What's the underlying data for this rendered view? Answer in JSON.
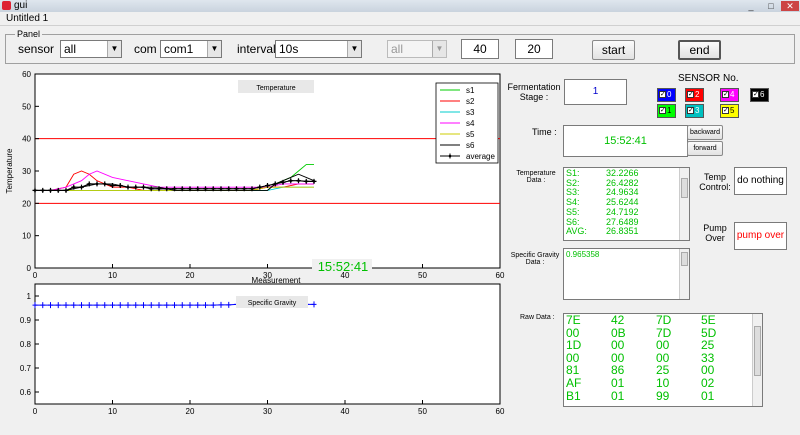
{
  "window": {
    "title": "gui",
    "icon": "matlab-figure-icon",
    "controls": [
      "_",
      "□",
      "✕"
    ]
  },
  "menubar": {
    "title": "Untitled 1"
  },
  "panel": {
    "title": "Panel",
    "sensor_label": "sensor",
    "sensor_value": "all",
    "com_label": "com",
    "com_value": "com1",
    "interval_label": "interval",
    "interval_value": "10s",
    "disabled_select_value": "all",
    "edit1_value": "40",
    "edit2_value": "20",
    "start_label": "start",
    "end_label": "end"
  },
  "temperature_axes": {
    "ylabel": "Temperature",
    "xlabel": "Measurement",
    "title_box": "Temperature",
    "xticks": [
      "0",
      "10",
      "20",
      "30",
      "40",
      "50",
      "60"
    ],
    "yticks": [
      "0",
      "10",
      "20",
      "30",
      "40",
      "50",
      "60"
    ],
    "overlay_time": "15:52:41"
  },
  "gravity_axes": {
    "title_box": "Specific Gravity",
    "xticks": [
      "0",
      "10",
      "20",
      "30",
      "40",
      "50",
      "60"
    ],
    "yticks": [
      "0.6",
      "0.7",
      "0.8",
      "0.9",
      "1"
    ]
  },
  "chart_data": [
    {
      "type": "line",
      "xlabel": "Measurement",
      "ylabel": "Temperature",
      "xlim": [
        0,
        60
      ],
      "ylim": [
        0,
        60
      ],
      "grid": false,
      "legend_placement": "top-right",
      "reference_lines": [
        {
          "y": 40,
          "color": "#ff0000"
        },
        {
          "y": 20,
          "color": "#ff0000"
        }
      ],
      "series": [
        {
          "name": "s1",
          "color": "#00cc00",
          "x": [
            0,
            2,
            4,
            6,
            8,
            10,
            12,
            14,
            16,
            18,
            20,
            22,
            24,
            26,
            28,
            30,
            31,
            32,
            33,
            34,
            35,
            36
          ],
          "y": [
            24,
            24,
            24,
            24,
            24,
            24,
            24,
            24,
            24,
            24,
            24,
            24,
            24,
            24,
            24,
            24,
            26,
            27,
            28,
            30,
            32,
            32
          ]
        },
        {
          "name": "s2",
          "color": "#ff0000",
          "x": [
            0,
            2,
            4,
            5,
            6,
            7,
            8,
            10,
            12,
            14,
            16,
            18,
            20,
            22,
            24,
            26,
            28,
            30,
            32,
            34,
            36
          ],
          "y": [
            24,
            24,
            25,
            29,
            30,
            29,
            27,
            25,
            25,
            24,
            24,
            24,
            24,
            24,
            24,
            24,
            24,
            25,
            25,
            26,
            26
          ]
        },
        {
          "name": "s3",
          "color": "#00cccc",
          "x": [
            0,
            4,
            8,
            12,
            16,
            20,
            24,
            28,
            30,
            32,
            34,
            36
          ],
          "y": [
            24,
            24,
            24,
            24,
            24,
            24,
            24,
            24,
            24,
            25,
            25,
            25
          ]
        },
        {
          "name": "s4",
          "color": "#ff00ff",
          "x": [
            0,
            2,
            4,
            6,
            7,
            8,
            10,
            12,
            14,
            16,
            18,
            20,
            22,
            24,
            26,
            28,
            30,
            32,
            34,
            36
          ],
          "y": [
            24,
            24,
            25,
            27,
            29,
            30,
            28,
            27,
            26,
            25,
            25,
            25,
            25,
            25,
            25,
            25,
            25,
            26,
            26,
            26
          ]
        },
        {
          "name": "s5",
          "color": "#cccc00",
          "x": [
            0,
            4,
            8,
            12,
            16,
            20,
            24,
            28,
            30,
            32,
            34,
            36
          ],
          "y": [
            24,
            24,
            24,
            24,
            24,
            24,
            24,
            24,
            25,
            25,
            25,
            25
          ]
        },
        {
          "name": "s6",
          "color": "#000000",
          "x": [
            0,
            2,
            4,
            6,
            8,
            10,
            12,
            14,
            16,
            18,
            20,
            22,
            24,
            26,
            28,
            30,
            31,
            32,
            33,
            34,
            35,
            36
          ],
          "y": [
            24,
            24,
            24,
            25,
            26,
            26,
            25,
            25,
            25,
            24,
            24,
            24,
            24,
            24,
            24,
            24,
            26,
            27,
            28,
            29,
            28,
            27
          ]
        },
        {
          "name": "average",
          "color": "#000000",
          "marker": "+",
          "x": [
            0,
            1,
            2,
            3,
            4,
            5,
            6,
            7,
            8,
            9,
            10,
            11,
            12,
            13,
            14,
            15,
            16,
            17,
            18,
            19,
            20,
            21,
            22,
            23,
            24,
            25,
            26,
            27,
            28,
            29,
            30,
            31,
            32,
            33,
            34,
            35,
            36
          ],
          "y": [
            24,
            24,
            24,
            24,
            24,
            25,
            25,
            26,
            26,
            26,
            25.5,
            25.5,
            25,
            25,
            25,
            24.5,
            24.5,
            24.5,
            24.5,
            24.5,
            24.5,
            24.5,
            24.5,
            24.5,
            24.5,
            24.5,
            24.5,
            24.5,
            24.5,
            25,
            25.5,
            26,
            26.5,
            27,
            27,
            26.8,
            26.8
          ]
        }
      ]
    },
    {
      "type": "line",
      "xlim": [
        0,
        60
      ],
      "ylim": [
        0.55,
        1.05
      ],
      "grid": false,
      "series": [
        {
          "color": "#0000ff",
          "marker": "+",
          "x": [
            0,
            1,
            2,
            3,
            4,
            5,
            6,
            7,
            8,
            9,
            10,
            11,
            12,
            13,
            14,
            15,
            16,
            17,
            18,
            19,
            20,
            21,
            22,
            23,
            24,
            25,
            26,
            27,
            28,
            29,
            30,
            31,
            32,
            33,
            34,
            35,
            36
          ],
          "y": [
            0.962,
            0.962,
            0.962,
            0.962,
            0.962,
            0.962,
            0.962,
            0.962,
            0.962,
            0.962,
            0.962,
            0.962,
            0.962,
            0.962,
            0.962,
            0.962,
            0.962,
            0.962,
            0.962,
            0.962,
            0.962,
            0.962,
            0.962,
            0.962,
            0.963,
            0.963,
            0.965,
            0.965,
            0.965,
            0.965,
            0.965,
            0.965,
            0.965,
            0.965,
            0.965,
            0.965,
            0.965
          ]
        }
      ]
    }
  ],
  "legend": {
    "entries": [
      "s1",
      "s2",
      "s3",
      "s4",
      "s5",
      "s6",
      "average"
    ]
  },
  "fermentation": {
    "label": "Fermentation\nStage :",
    "value": "1"
  },
  "sensor_no": {
    "title": "SENSOR No.",
    "items": [
      {
        "num": "0",
        "color": "#0000ff"
      },
      {
        "num": "2",
        "color": "#ff0000"
      },
      {
        "num": "4",
        "color": "#ff00ff"
      },
      {
        "num": "6",
        "color": "#000000"
      },
      {
        "num": "1",
        "color": "#00ff00"
      },
      {
        "num": "3",
        "color": "#00c0c0"
      },
      {
        "num": "5",
        "color": "#ffff00"
      }
    ]
  },
  "time": {
    "label": "Time :",
    "value": "15:52:41",
    "backward_label": "backward",
    "forward_label": "forward"
  },
  "temperature_data": {
    "label": "Temperature\nData :",
    "rows": [
      {
        "k": "S1:",
        "v": "32.2266"
      },
      {
        "k": "S2:",
        "v": "26.4282"
      },
      {
        "k": "S3:",
        "v": "24.9634"
      },
      {
        "k": "S4:",
        "v": "25.6244"
      },
      {
        "k": "S5:",
        "v": "24.7192"
      },
      {
        "k": "S6:",
        "v": "27.6489"
      },
      {
        "k": "AVG:",
        "v": "26.8351"
      }
    ]
  },
  "temp_control": {
    "label": "Temp\nControl:",
    "value": "do nothing"
  },
  "pump_over": {
    "label": "Pump\nOver",
    "value": "pump over",
    "value_color": "#ff0000"
  },
  "specific_gravity_data": {
    "label": "Specific Gravity\nData :",
    "value": "0.965358"
  },
  "raw_data": {
    "label": "Raw Data :",
    "rows": [
      [
        "7E",
        "42",
        "7D",
        "5E"
      ],
      [
        "00",
        "0B",
        "7D",
        "5D"
      ],
      [
        "1D",
        "00",
        "00",
        "25"
      ],
      [
        "00",
        "00",
        "00",
        "33"
      ],
      [
        "81",
        "86",
        "25",
        "00"
      ],
      [
        "AF",
        "01",
        "10",
        "02"
      ],
      [
        "B1",
        "01",
        "99",
        "01"
      ]
    ]
  }
}
